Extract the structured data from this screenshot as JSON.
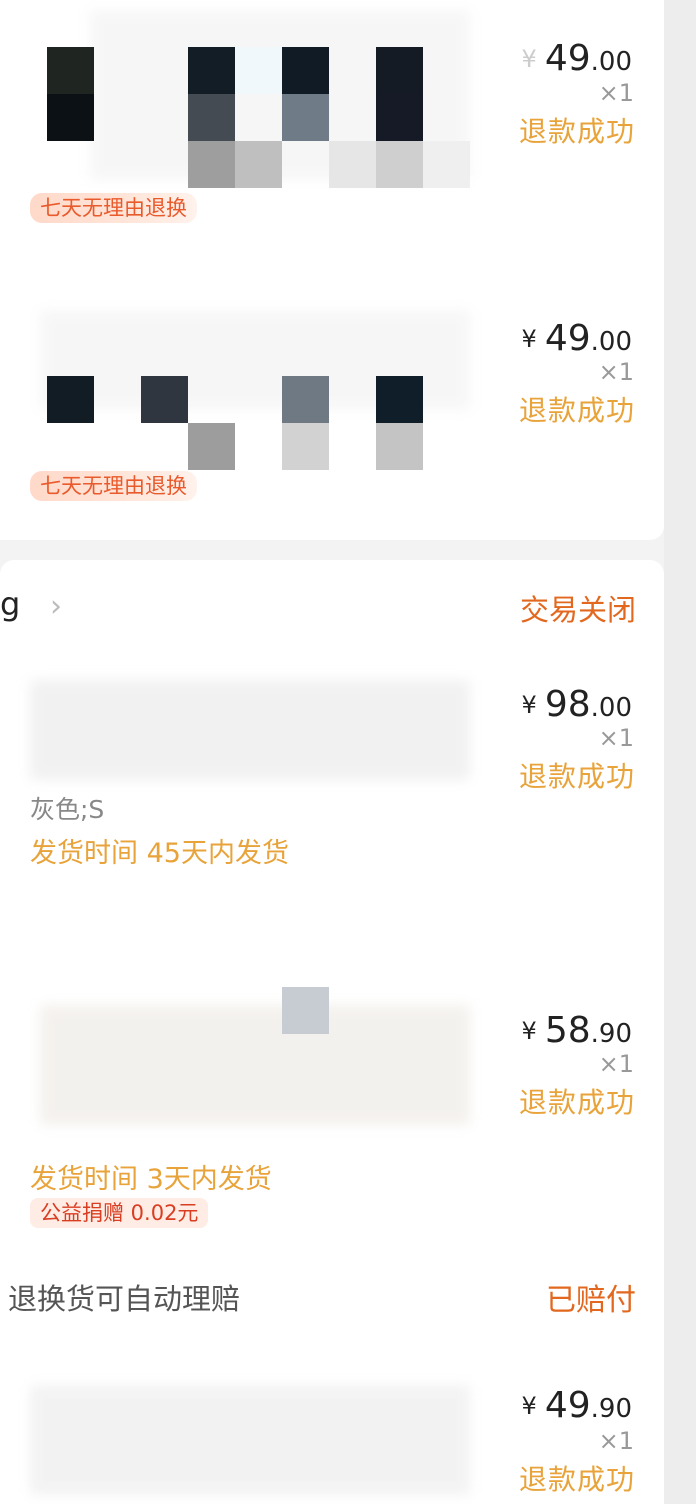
{
  "orders": {
    "top_items": [
      {
        "price_yen": "¥",
        "price_int": "49",
        "price_dec": ".00",
        "qty": "×1",
        "status": "退款成功",
        "tag": "七天无理由退换"
      },
      {
        "price_yen": "¥",
        "price_int": "49",
        "price_dec": ".00",
        "qty": "×1",
        "status": "退款成功",
        "tag": "七天无理由退换"
      }
    ],
    "shop": {
      "name": "g",
      "status": "交易关闭"
    },
    "items": [
      {
        "price_yen": "¥",
        "price_int": "98",
        "price_dec": ".00",
        "qty": "×1",
        "status": "退款成功",
        "sku": "灰色;S",
        "ship": "发货时间  45天内发货"
      },
      {
        "price_yen": "¥",
        "price_int": "58",
        "price_dec": ".90",
        "qty": "×1",
        "status": "退款成功",
        "ship": "发货时间  3天内发货",
        "donation": "公益捐赠 0.02元"
      }
    ],
    "claim": {
      "label": "退换货可自动理赔",
      "status": "已赔付"
    },
    "last_item": {
      "price_yen": "¥",
      "price_int": "49",
      "price_dec": ".90",
      "qty": "×1",
      "status": "退款成功"
    }
  },
  "colors": {
    "accent_orange": "#e8a33a",
    "status_red": "#e2681f"
  }
}
